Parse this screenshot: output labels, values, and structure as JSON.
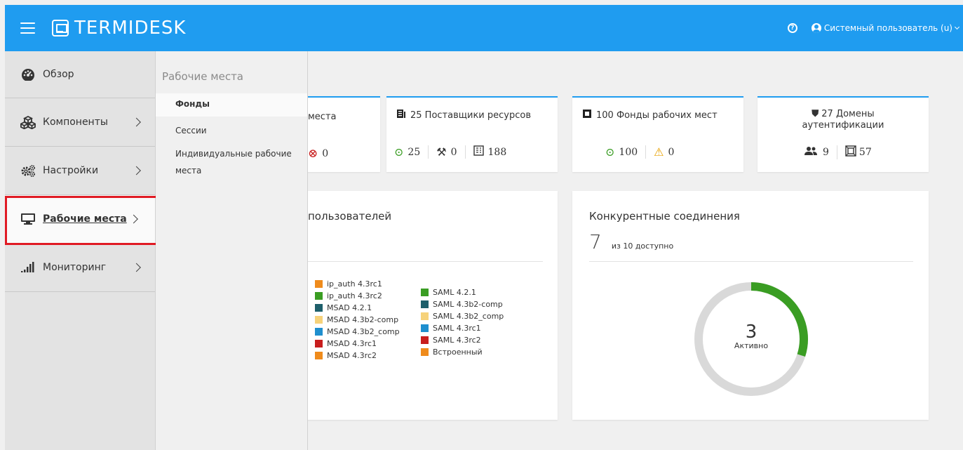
{
  "header": {
    "brand": "TERMIDESK",
    "user_label": "Системный пользователь (u)"
  },
  "sidebar": {
    "items": [
      {
        "label": "Обзор",
        "icon": "dashboard-icon"
      },
      {
        "label": "Компоненты",
        "icon": "cubes-icon"
      },
      {
        "label": "Настройки",
        "icon": "cogs-icon"
      },
      {
        "label": "Рабочие места",
        "icon": "desktop-icon"
      },
      {
        "label": "Мониторинг",
        "icon": "signal-bars-icon"
      }
    ]
  },
  "submenu": {
    "title": "Рабочие места",
    "items": [
      {
        "label": "Фонды"
      },
      {
        "label": "Сессии"
      },
      {
        "label": "Индивидуальные рабочие места"
      }
    ]
  },
  "cards": {
    "workplaces": {
      "title": "места",
      "failed": "0"
    },
    "providers": {
      "title": "25 Поставщики ресурсов",
      "ok": "25",
      "maintenance": "0",
      "templates": "188"
    },
    "pools": {
      "title": "100 Фонды рабочих мест",
      "ok": "100",
      "warn": "0"
    },
    "domains": {
      "title": "27 Домены аутентификации",
      "users": "9",
      "groups": "57"
    }
  },
  "users_panel": {
    "title": "пользователей",
    "legend_col1": [
      {
        "label": "ip_auth 4.3rc1",
        "color": "#ef8b1c"
      },
      {
        "label": "ip_auth 4.3rc2",
        "color": "#3a9d23"
      },
      {
        "label": "MSAD 4.2.1",
        "color": "#1e5f6b"
      },
      {
        "label": "MSAD 4.3b2-comp",
        "color": "#f6d27a"
      },
      {
        "label": "MSAD 4.3b2_comp",
        "color": "#1f8fce"
      },
      {
        "label": "MSAD 4.3rc1",
        "color": "#c81e1e"
      },
      {
        "label": "MSAD 4.3rc2",
        "color": "#ef8b1c"
      }
    ],
    "legend_col2": [
      {
        "label": "SAML 4.2.1",
        "color": "#3a9d23"
      },
      {
        "label": "SAML 4.3b2-comp",
        "color": "#1e5f6b"
      },
      {
        "label": "SAML 4.3b2_comp",
        "color": "#f6d27a"
      },
      {
        "label": "SAML 4.3rc1",
        "color": "#1f8fce"
      },
      {
        "label": "SAML 4.3rc2",
        "color": "#c81e1e"
      },
      {
        "label": "Встроенный",
        "color": "#ef8b1c"
      }
    ]
  },
  "connections_panel": {
    "title": "Конкурентные соединения",
    "current": "7",
    "available_text": "из 10 доступно",
    "active_count": "3",
    "active_label": "Активно",
    "active_fraction": 0.3
  },
  "colors": {
    "accent": "#1f9cf0",
    "ok": "#3a9d23",
    "error": "#c81e1e",
    "warning": "#e8a100",
    "highlight": "#e01b24",
    "donut_track": "#d9d9d9"
  }
}
